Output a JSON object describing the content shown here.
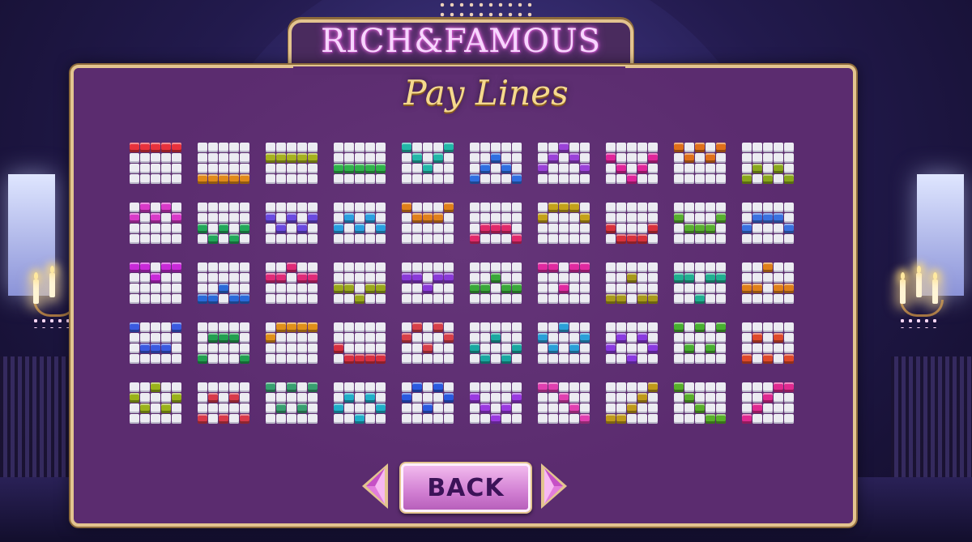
{
  "header": {
    "logo_text": "RICH&FAMOUS",
    "title": "Pay Lines"
  },
  "controls": {
    "back_label": "BACK",
    "prev_icon": "gem-left-arrow-icon",
    "next_icon": "gem-right-arrow-icon"
  },
  "colors": {
    "panel": "#5b2c6f",
    "gold_border": "#e3c48f",
    "empty_cell": "#ececf2",
    "back_button": "#d17ed2"
  },
  "paylines": [
    {
      "color": "#e8323c",
      "rows": [
        0,
        0,
        0,
        0,
        0
      ]
    },
    {
      "color": "#e08a1a",
      "rows": [
        3,
        3,
        3,
        3,
        3
      ]
    },
    {
      "color": "#a6b21e",
      "rows": [
        1,
        1,
        1,
        1,
        1
      ]
    },
    {
      "color": "#2fb34a",
      "rows": [
        2,
        2,
        2,
        2,
        2
      ]
    },
    {
      "color": "#22b8a8",
      "rows": [
        0,
        1,
        2,
        1,
        0
      ]
    },
    {
      "color": "#2f6fe0",
      "rows": [
        3,
        2,
        1,
        2,
        3
      ]
    },
    {
      "color": "#9a42d8",
      "rows": [
        2,
        1,
        0,
        1,
        2
      ]
    },
    {
      "color": "#e0259a",
      "rows": [
        1,
        2,
        3,
        2,
        1
      ]
    },
    {
      "color": "#e0701a",
      "rows": [
        0,
        1,
        0,
        1,
        0
      ]
    },
    {
      "color": "#8aa81c",
      "rows": [
        3,
        2,
        3,
        2,
        3
      ]
    },
    {
      "color": "#d83ac8",
      "rows": [
        1,
        0,
        1,
        0,
        1
      ]
    },
    {
      "color": "#22a85a",
      "rows": [
        2,
        3,
        2,
        3,
        2
      ]
    },
    {
      "color": "#6a4ae0",
      "rows": [
        1,
        2,
        1,
        2,
        1
      ]
    },
    {
      "color": "#2aa0e0",
      "rows": [
        2,
        1,
        2,
        1,
        2
      ]
    },
    {
      "color": "#e0801a",
      "rows": [
        0,
        1,
        1,
        1,
        0
      ]
    },
    {
      "color": "#e02a6a",
      "rows": [
        3,
        2,
        2,
        2,
        3
      ]
    },
    {
      "color": "#c4a21a",
      "rows": [
        1,
        0,
        0,
        0,
        1
      ]
    },
    {
      "color": "#d8323c",
      "rows": [
        2,
        3,
        3,
        3,
        2
      ]
    },
    {
      "color": "#58b030",
      "rows": [
        1,
        2,
        2,
        2,
        1
      ]
    },
    {
      "color": "#3a72e0",
      "rows": [
        2,
        1,
        1,
        1,
        2
      ]
    },
    {
      "color": "#c82ad8",
      "rows": [
        0,
        0,
        1,
        0,
        0
      ]
    },
    {
      "color": "#2a6ad8",
      "rows": [
        3,
        3,
        2,
        3,
        3
      ]
    },
    {
      "color": "#e02a78",
      "rows": [
        1,
        1,
        0,
        1,
        1
      ]
    },
    {
      "color": "#9aa81c",
      "rows": [
        2,
        2,
        3,
        2,
        2
      ]
    },
    {
      "color": "#8a3ad8",
      "rows": [
        1,
        1,
        2,
        1,
        1
      ]
    },
    {
      "color": "#3aa83a",
      "rows": [
        2,
        2,
        1,
        2,
        2
      ]
    },
    {
      "color": "#e02aa0",
      "rows": [
        0,
        0,
        2,
        0,
        0
      ]
    },
    {
      "color": "#a89a1a",
      "rows": [
        3,
        3,
        1,
        3,
        3
      ]
    },
    {
      "color": "#20b090",
      "rows": [
        1,
        1,
        3,
        1,
        1
      ]
    },
    {
      "color": "#e0801a",
      "rows": [
        2,
        2,
        0,
        2,
        2
      ]
    },
    {
      "color": "#3a5ae0",
      "rows": [
        0,
        2,
        2,
        2,
        0
      ]
    },
    {
      "color": "#22a050",
      "rows": [
        3,
        1,
        1,
        1,
        3
      ]
    },
    {
      "color": "#e0901a",
      "rows": [
        1,
        0,
        0,
        0,
        0
      ]
    },
    {
      "color": "#d83040",
      "rows": [
        2,
        3,
        3,
        3,
        3
      ]
    },
    {
      "color": "#d84048",
      "rows": [
        1,
        0,
        2,
        0,
        1
      ]
    },
    {
      "color": "#1aa8a0",
      "rows": [
        2,
        3,
        1,
        3,
        2
      ]
    },
    {
      "color": "#2aa0d8",
      "rows": [
        1,
        2,
        0,
        2,
        1
      ]
    },
    {
      "color": "#8a3ae0",
      "rows": [
        2,
        1,
        3,
        1,
        2
      ]
    },
    {
      "color": "#48b030",
      "rows": [
        0,
        2,
        0,
        2,
        0
      ]
    },
    {
      "color": "#e04a2a",
      "rows": [
        3,
        1,
        3,
        1,
        3
      ]
    },
    {
      "color": "#9ab21a",
      "rows": [
        1,
        2,
        0,
        2,
        1
      ]
    },
    {
      "color": "#d83a4a",
      "rows": [
        3,
        1,
        3,
        1,
        3
      ]
    },
    {
      "color": "#38a070",
      "rows": [
        0,
        2,
        0,
        2,
        0
      ]
    },
    {
      "color": "#20b0c8",
      "rows": [
        2,
        1,
        3,
        1,
        2
      ]
    },
    {
      "color": "#2a5ae0",
      "rows": [
        1,
        0,
        2,
        0,
        1
      ]
    },
    {
      "color": "#9a3ae0",
      "rows": [
        1,
        2,
        3,
        2,
        1
      ]
    },
    {
      "color": "#e040b0",
      "rows": [
        0,
        0,
        1,
        2,
        3
      ]
    },
    {
      "color": "#c09a1a",
      "rows": [
        3,
        3,
        2,
        1,
        0
      ]
    },
    {
      "color": "#58b02a",
      "rows": [
        0,
        1,
        2,
        3,
        3
      ]
    },
    {
      "color": "#e02a90",
      "rows": [
        3,
        2,
        1,
        0,
        0
      ]
    }
  ]
}
